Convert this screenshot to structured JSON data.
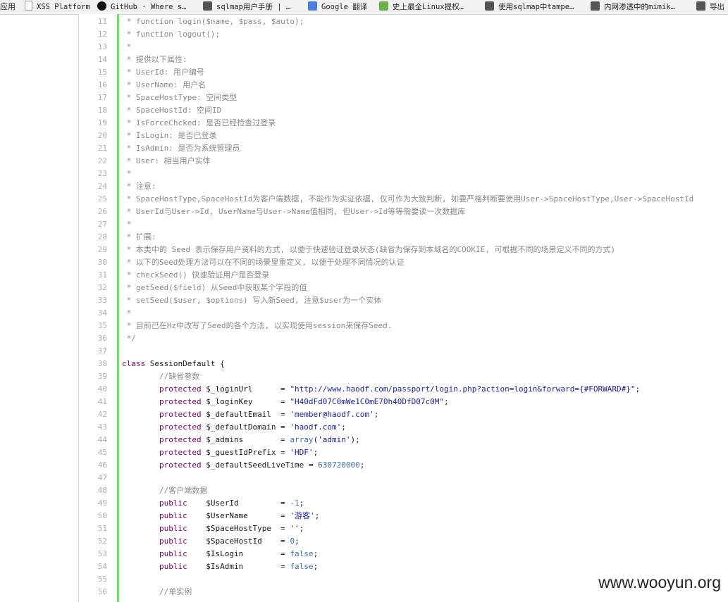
{
  "bookmarks": [
    {
      "label": "应用",
      "icon": "apps-icon"
    },
    {
      "label": "XSS Platform",
      "icon": "page-icon"
    },
    {
      "label": "GitHub · Where s…",
      "icon": "github-icon"
    },
    {
      "label": "sqlmap用户手册 | …",
      "icon": "image-icon"
    },
    {
      "label": "Google 翻译",
      "icon": "google-translate-icon"
    },
    {
      "label": "史上最全Linux提权…",
      "icon": "f-icon"
    },
    {
      "label": "使用sqlmap中tampe…",
      "icon": "image-icon"
    },
    {
      "label": "内网渗透中的mimik…",
      "icon": "image-icon"
    },
    {
      "label": "导出",
      "icon": "image-icon"
    }
  ],
  "code_lines": [
    {
      "n": "11",
      "c": " * function login($name, $pass, $auto);"
    },
    {
      "n": "12",
      "c": " * function logout();"
    },
    {
      "n": "13",
      "c": " *"
    },
    {
      "n": "14",
      "c": " * 提供以下属性:"
    },
    {
      "n": "15",
      "c": " * UserId: 用户编号"
    },
    {
      "n": "16",
      "c": " * UserName: 用户名"
    },
    {
      "n": "17",
      "c": " * SpaceHostType: 空间类型"
    },
    {
      "n": "18",
      "c": " * SpaceHostId: 空间ID"
    },
    {
      "n": "19",
      "c": " * IsForceChcked: 是否已经检查过登录"
    },
    {
      "n": "20",
      "c": " * IsLogin: 是否已登录"
    },
    {
      "n": "21",
      "c": " * IsAdmin: 是否为系统管理员"
    },
    {
      "n": "22",
      "c": " * User: 相当用户实体"
    },
    {
      "n": "23",
      "c": " *"
    },
    {
      "n": "24",
      "c": " * 注意:"
    },
    {
      "n": "25",
      "c": " * SpaceHostType,SpaceHostId为客户端数据, 不能作为实证依据, 仅可作为大致判断, 如要严格判断要使用User->SpaceHostType,User->SpaceHostId"
    },
    {
      "n": "26",
      "c": " * UserId与User->Id, UserName与User->Name值相同, 但User->Id等等需要读一次数据库"
    },
    {
      "n": "27",
      "c": " *"
    },
    {
      "n": "28",
      "c": " * 扩展:"
    },
    {
      "n": "29",
      "c": " * 本类中的 Seed 表示保存用户资料的方式, 以便于快速验证登录状态(缺省为保存到本域名的COOKIE, 可根据不同的场景定义不同的方式)"
    },
    {
      "n": "30",
      "c": " * 以下的Seed处理方法可以在不同的场景里重定义, 以便于处理不同情况的认证"
    },
    {
      "n": "31",
      "c": " * checkSeed() 快速验证用户是否登录"
    },
    {
      "n": "32",
      "c": " * getSeed($field) 从Seed中获取某个字段的值"
    },
    {
      "n": "33",
      "c": " * setSeed($user, $options) 写入新Seed, 注意$user为一个实体"
    },
    {
      "n": "34",
      "c": " *"
    },
    {
      "n": "35",
      "c": " * 目前已在Hz中改写了Seed的各个方法, 以实现使用session来保存Seed."
    },
    {
      "n": "36",
      "c": " */"
    },
    {
      "n": "37",
      "c": ""
    },
    {
      "n": "38",
      "c": "class SessionDefault {"
    },
    {
      "n": "39",
      "c": "        //缺省参数"
    },
    {
      "n": "40",
      "c": "        protected $_loginUrl      = \"http://www.haodf.com/passport/login.php?action=login&forward={#FORWARD#}\";"
    },
    {
      "n": "41",
      "c": "        protected $_loginKey      = \"H40dFd07C0mWe1C0mE70h40DfD07c0M\";"
    },
    {
      "n": "42",
      "c": "        protected $_defaultEmail  = 'member@haodf.com';"
    },
    {
      "n": "43",
      "c": "        protected $_defaultDomain = 'haodf.com';"
    },
    {
      "n": "44",
      "c": "        protected $_admins        = array('admin');"
    },
    {
      "n": "45",
      "c": "        protected $_guestIdPrefix = 'HDF';"
    },
    {
      "n": "46",
      "c": "        protected $_defaultSeedLiveTime = 630720000;"
    },
    {
      "n": "47",
      "c": ""
    },
    {
      "n": "48",
      "c": "        //客户端数据"
    },
    {
      "n": "49",
      "c": "        public    $UserId         = -1;"
    },
    {
      "n": "50",
      "c": "        public    $UserName       = '游客';"
    },
    {
      "n": "51",
      "c": "        public    $SpaceHostType  = '';"
    },
    {
      "n": "52",
      "c": "        public    $SpaceHostId    = 0;"
    },
    {
      "n": "53",
      "c": "        public    $IsLogin        = false;"
    },
    {
      "n": "54",
      "c": "        public    $IsAdmin        = false;"
    },
    {
      "n": "55",
      "c": ""
    },
    {
      "n": "56",
      "c": "        //单实例"
    }
  ],
  "watermark": "www.wooyun.org",
  "colors": {
    "gutter_accent": "#6ce26c",
    "comment": "#8a8a8a",
    "keyword": "#7a0066",
    "string": "#2020a0",
    "number": "#3a6fb0"
  }
}
